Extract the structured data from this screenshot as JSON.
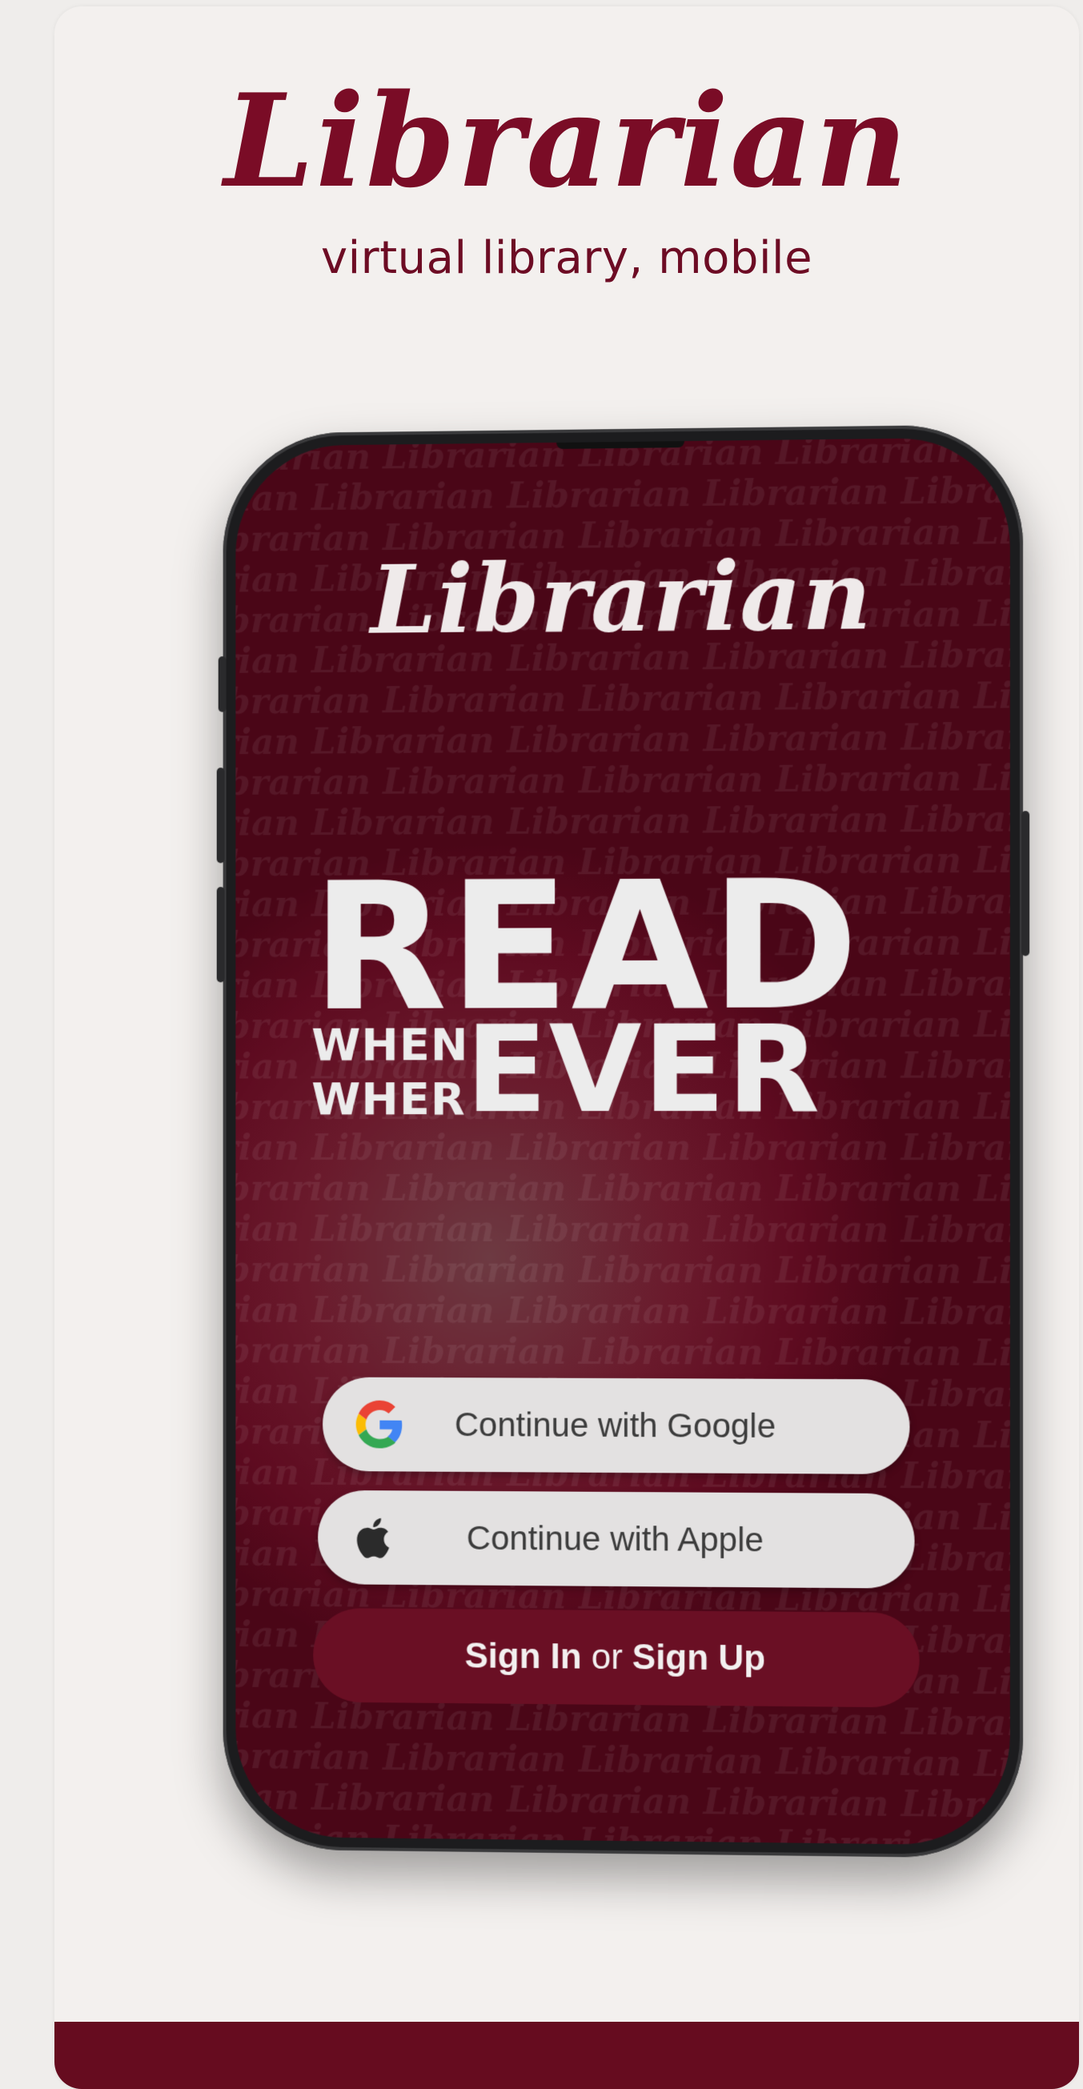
{
  "header": {
    "title": "Librarian",
    "subtitle": "virtual library, mobile"
  },
  "phone": {
    "app_title": "Librarian",
    "background_word": "Librarian",
    "hero": {
      "read": "READ",
      "when": "WHEN",
      "wher": "WHER",
      "ever": "EVER"
    },
    "buttons": {
      "google": "Continue with Google",
      "apple": "Continue with Apple",
      "sign_in": "Sign In",
      "or": "or",
      "sign_up": "Sign Up"
    }
  },
  "icons": {
    "google": "google-logo-icon",
    "apple": "apple-logo-icon"
  },
  "colors": {
    "brand": "#7a0c26",
    "screen_bg": "#5e0b20",
    "footer": "#660c1f",
    "button_light": "#e3e1e1",
    "button_dark": "#6a0f24"
  }
}
